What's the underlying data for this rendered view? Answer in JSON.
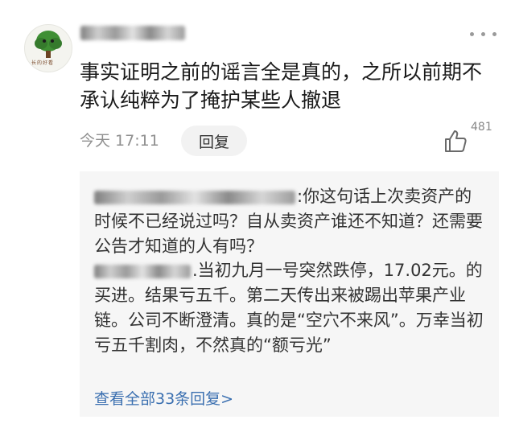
{
  "post": {
    "avatar_caption": "长的好看",
    "username": "",
    "text": "事实证明之前的谣言全是真的，之所以前期不承认纯粹为了掩护某些人撤退",
    "time": "今天 17:11",
    "reply_label": "回复",
    "like_count": "481"
  },
  "replies": [
    {
      "author": "",
      "text": ":你这句话上次卖资产的时候不已经说过吗？自从卖资产谁还不知道？还需要公告才知道的人有吗？"
    },
    {
      "author": "",
      "text": ".当初九月一号突然跌停，17.02元。的买进。结果亏五千。第二天传出来被踢出苹果产业链。公司不断澄清。真的是“空穴不来风”。万幸当初亏五千割肉，不然真的“额亏光”"
    }
  ],
  "view_all_replies": "查看全部33条回复>",
  "colors": {
    "link": "#3a6fb0",
    "meta": "#8f8f8f",
    "reply_bg": "#f6f6f6"
  }
}
